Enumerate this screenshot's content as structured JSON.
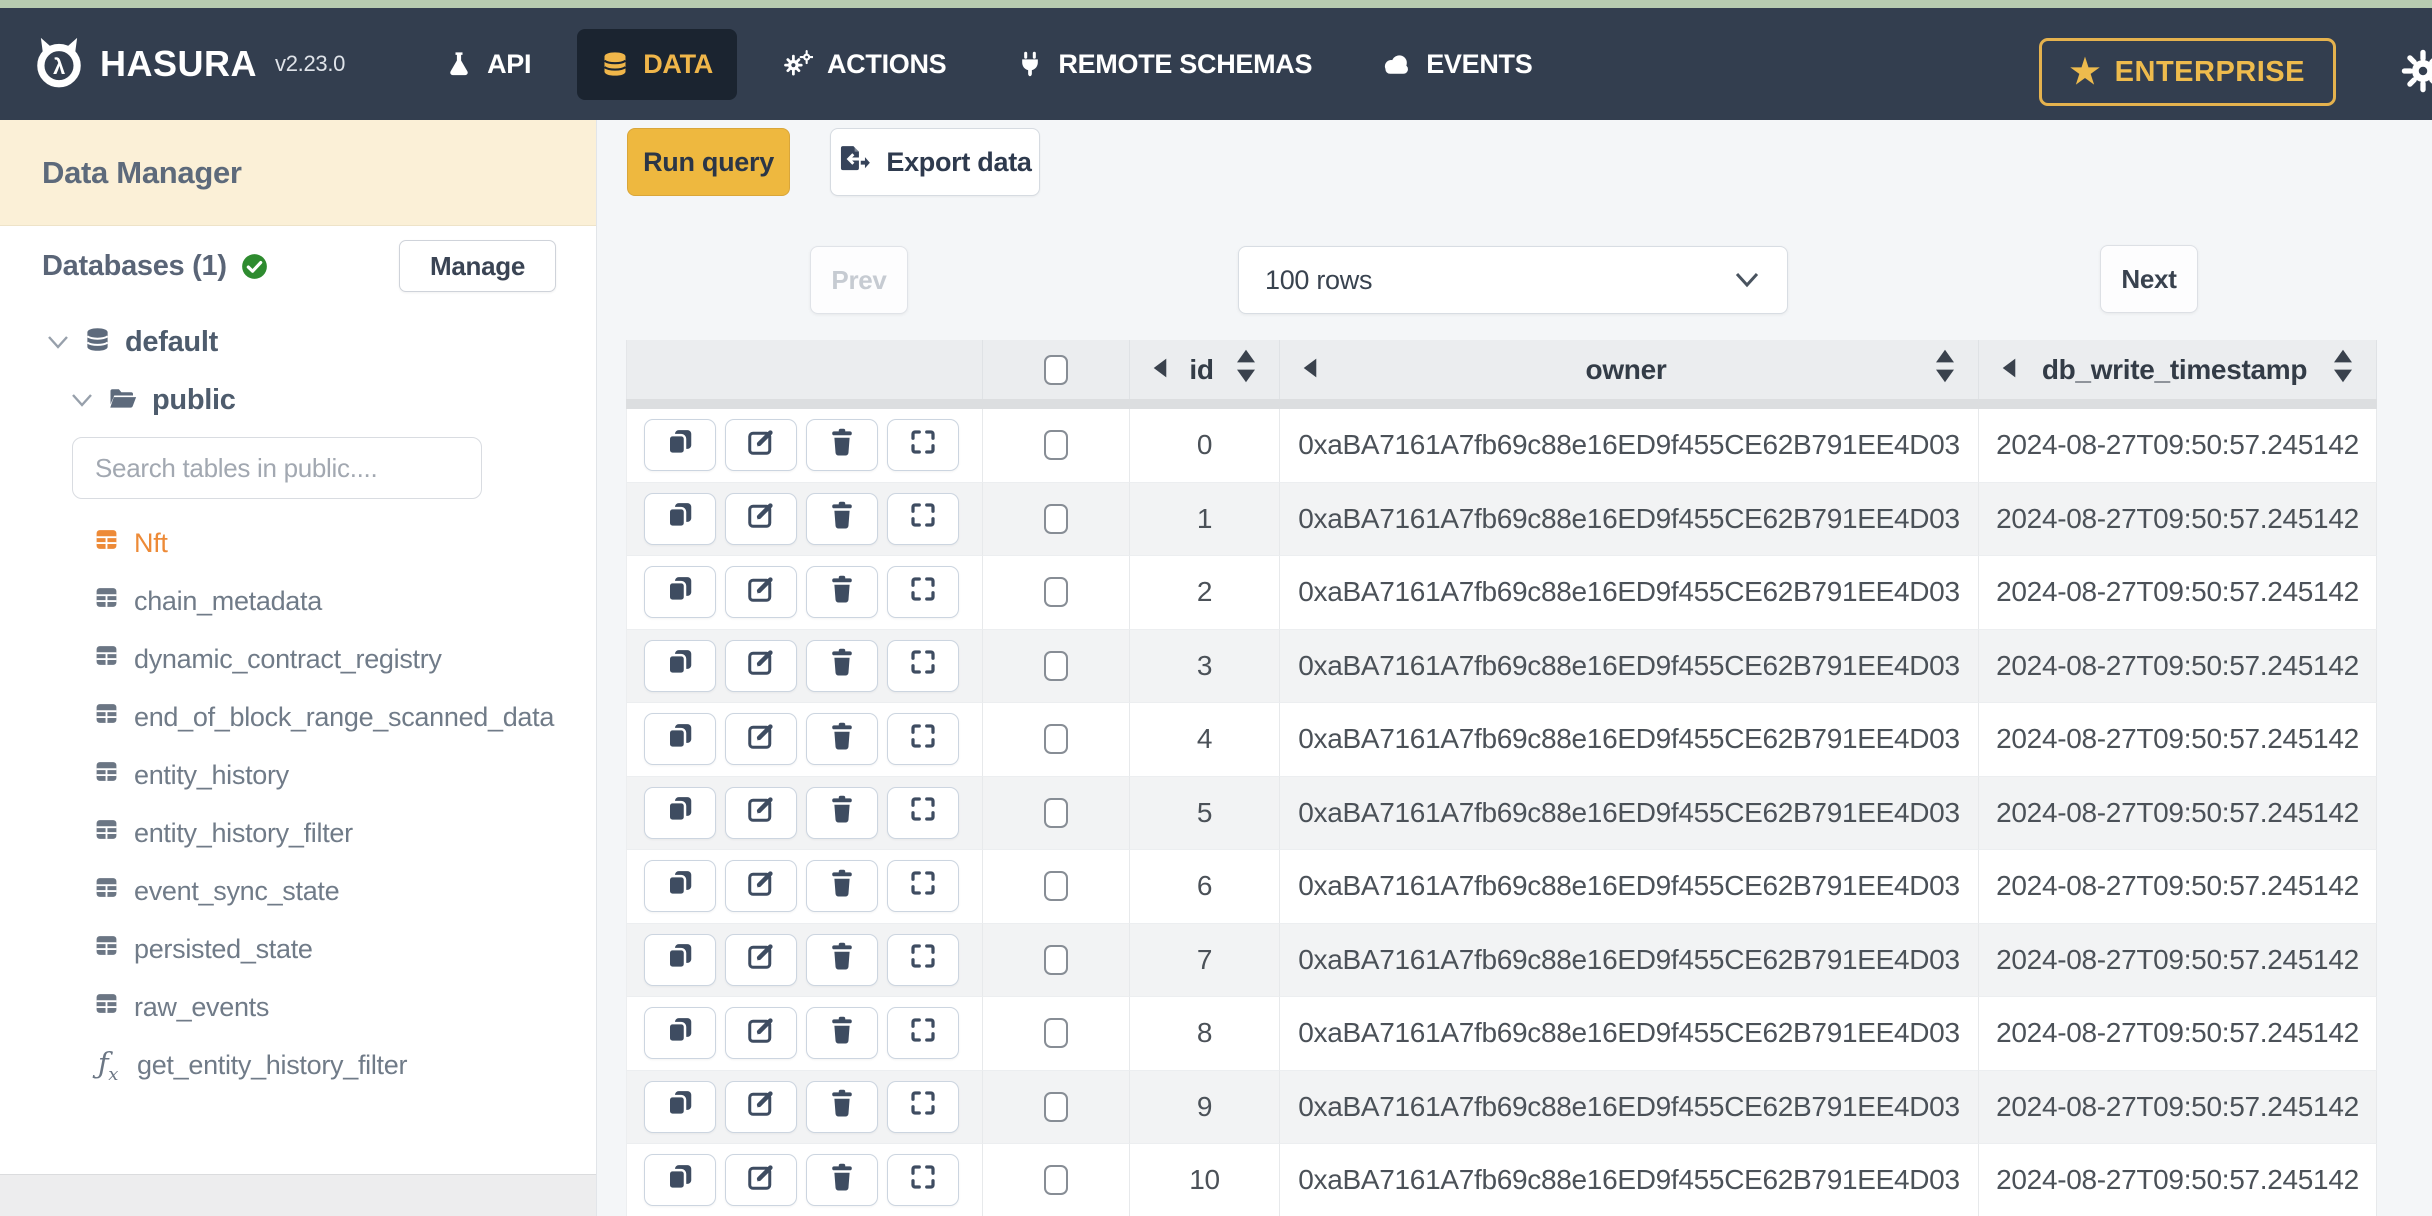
{
  "topbar": {
    "brand": "HASURA",
    "version": "v2.23.0",
    "nav_items": [
      {
        "label": "API",
        "icon": "flask-icon",
        "active": false
      },
      {
        "label": "DATA",
        "icon": "database-icon",
        "active": true
      },
      {
        "label": "ACTIONS",
        "icon": "gears-icon",
        "active": false
      },
      {
        "label": "REMOTE SCHEMAS",
        "icon": "plug-icon",
        "active": false
      },
      {
        "label": "EVENTS",
        "icon": "cloud-icon",
        "active": false
      }
    ],
    "enterprise_label": "ENTERPRISE",
    "colors": {
      "bar": "#333e4f",
      "active_tab_bg": "#1b2430",
      "accent_gold": "#f0b64a"
    }
  },
  "sidebar": {
    "title": "Data Manager",
    "databases_label": "Databases (1)",
    "manage_label": "Manage",
    "tree": {
      "database_label": "default",
      "schema_label": "public"
    },
    "search_placeholder": "Search tables in public....",
    "tables": [
      {
        "name": "Nft",
        "active": true
      },
      {
        "name": "chain_metadata",
        "active": false
      },
      {
        "name": "dynamic_contract_registry",
        "active": false
      },
      {
        "name": "end_of_block_range_scanned_data",
        "active": false
      },
      {
        "name": "entity_history",
        "active": false
      },
      {
        "name": "entity_history_filter",
        "active": false
      },
      {
        "name": "event_sync_state",
        "active": false
      },
      {
        "name": "persisted_state",
        "active": false
      },
      {
        "name": "raw_events",
        "active": false
      }
    ],
    "function_item": {
      "name": "get_entity_history_filter"
    },
    "colors": {
      "header_bg": "#fbf0d7",
      "active_item": "#ed8a37",
      "check_green": "#2e8b2f"
    }
  },
  "toolbar": {
    "run_query_label": "Run query",
    "export_data_label": "Export data"
  },
  "pagination": {
    "prev_label": "Prev",
    "page_size_value": "100 rows",
    "next_label": "Next"
  },
  "data_table": {
    "columns": [
      {
        "key": "id",
        "label": "id"
      },
      {
        "key": "owner",
        "label": "owner"
      },
      {
        "key": "db_write_timestamp",
        "label": "db_write_timestamp"
      }
    ],
    "row_actions": [
      "clone",
      "edit",
      "delete",
      "expand"
    ],
    "rows": [
      {
        "id": "0",
        "owner": "0xaBA7161A7fb69c88e16ED9f455CE62B791EE4D03",
        "db_write_timestamp": "2024-08-27T09:50:57.245142"
      },
      {
        "id": "1",
        "owner": "0xaBA7161A7fb69c88e16ED9f455CE62B791EE4D03",
        "db_write_timestamp": "2024-08-27T09:50:57.245142"
      },
      {
        "id": "2",
        "owner": "0xaBA7161A7fb69c88e16ED9f455CE62B791EE4D03",
        "db_write_timestamp": "2024-08-27T09:50:57.245142"
      },
      {
        "id": "3",
        "owner": "0xaBA7161A7fb69c88e16ED9f455CE62B791EE4D03",
        "db_write_timestamp": "2024-08-27T09:50:57.245142"
      },
      {
        "id": "4",
        "owner": "0xaBA7161A7fb69c88e16ED9f455CE62B791EE4D03",
        "db_write_timestamp": "2024-08-27T09:50:57.245142"
      },
      {
        "id": "5",
        "owner": "0xaBA7161A7fb69c88e16ED9f455CE62B791EE4D03",
        "db_write_timestamp": "2024-08-27T09:50:57.245142"
      },
      {
        "id": "6",
        "owner": "0xaBA7161A7fb69c88e16ED9f455CE62B791EE4D03",
        "db_write_timestamp": "2024-08-27T09:50:57.245142"
      },
      {
        "id": "7",
        "owner": "0xaBA7161A7fb69c88e16ED9f455CE62B791EE4D03",
        "db_write_timestamp": "2024-08-27T09:50:57.245142"
      },
      {
        "id": "8",
        "owner": "0xaBA7161A7fb69c88e16ED9f455CE62B791EE4D03",
        "db_write_timestamp": "2024-08-27T09:50:57.245142"
      },
      {
        "id": "9",
        "owner": "0xaBA7161A7fb69c88e16ED9f455CE62B791EE4D03",
        "db_write_timestamp": "2024-08-27T09:50:57.245142"
      },
      {
        "id": "10",
        "owner": "0xaBA7161A7fb69c88e16ED9f455CE62B791EE4D03",
        "db_write_timestamp": "2024-08-27T09:50:57.245142"
      }
    ]
  }
}
